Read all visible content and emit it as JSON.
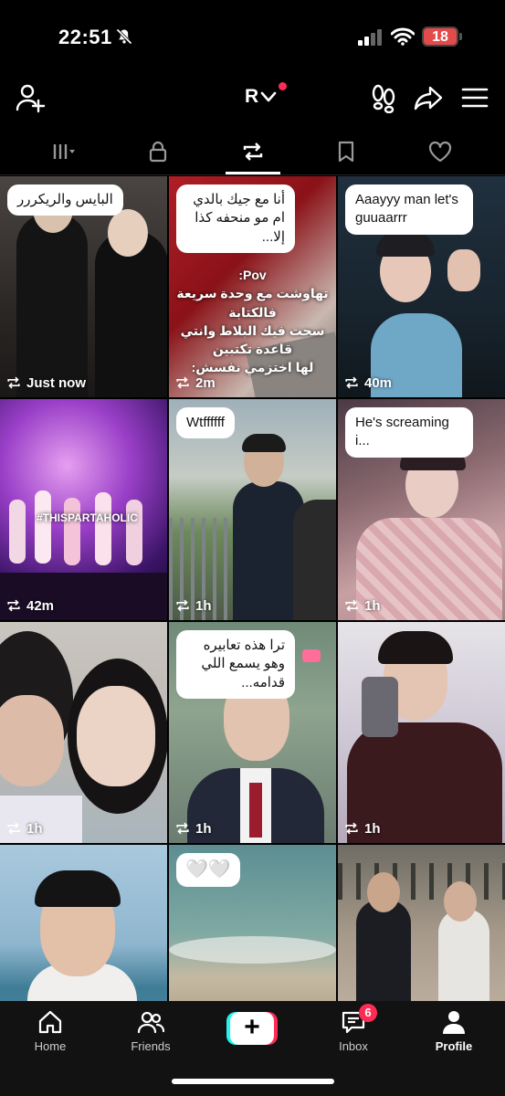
{
  "status_bar": {
    "time": "22:51",
    "battery": "18"
  },
  "header": {
    "username": "R"
  },
  "tabs": [
    "videos",
    "private",
    "reposts",
    "favorites",
    "liked"
  ],
  "grid": [
    {
      "caption": "البايس والريكررر",
      "time": "Just now"
    },
    {
      "caption": "أنا مع جيك بالدي ام مو منحفه كذا إلا...",
      "overlay": "Pov:\nتهاوشت مع وحدة سريعة فالكتابة\nسحت فيك البلاط وانتي قاعدة تكتبين\nلها اختزمي نفسش:",
      "time": "2m"
    },
    {
      "caption": "Aaayyy man let's guuaarrr",
      "time": "40m"
    },
    {
      "caption": "",
      "overlay": "#THISPARTAHOLIC",
      "time": "42m"
    },
    {
      "caption": "Wtffffff",
      "time": "1h"
    },
    {
      "caption": "He's screaming i...",
      "time": "1h"
    },
    {
      "caption": "",
      "time": "1h"
    },
    {
      "caption": "ترا هذه تعابيره وهو يسمع اللي قدامه...",
      "time": "1h"
    },
    {
      "caption": "",
      "time": "1h"
    },
    {
      "caption": "",
      "time": ""
    },
    {
      "caption": "🤍🤍",
      "time": ""
    },
    {
      "caption": "",
      "time": ""
    }
  ],
  "bottom_nav": {
    "home": "Home",
    "friends": "Friends",
    "inbox": "Inbox",
    "inbox_badge": "6",
    "profile": "Profile"
  },
  "colors": {
    "accent_red": "#fe2c55",
    "accent_cyan": "#25f4ee"
  }
}
